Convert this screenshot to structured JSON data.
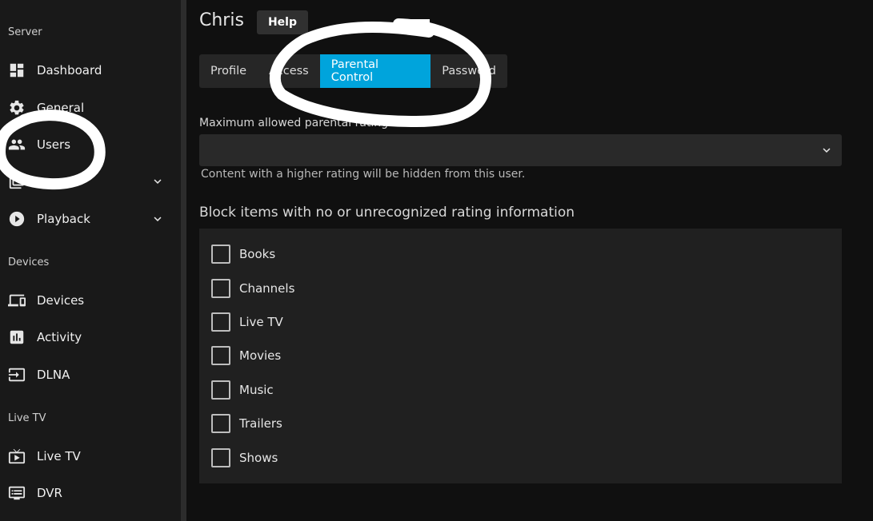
{
  "sidebar": {
    "sections": {
      "server": "Server",
      "devices": "Devices",
      "live_tv": "Live TV"
    },
    "items": [
      {
        "label": "Dashboard",
        "icon": "dashboard-icon"
      },
      {
        "label": "General",
        "icon": "gear-icon"
      },
      {
        "label": "Users",
        "icon": "users-icon"
      },
      {
        "label": "",
        "icon": "library-icon"
      },
      {
        "label": "Playback",
        "icon": "play-circle-icon"
      },
      {
        "label": "Devices",
        "icon": "devices-icon"
      },
      {
        "label": "Activity",
        "icon": "activity-icon"
      },
      {
        "label": "DLNA",
        "icon": "dlna-icon"
      },
      {
        "label": "Live TV",
        "icon": "live-tv-icon"
      },
      {
        "label": "DVR",
        "icon": "dvr-icon"
      }
    ]
  },
  "header": {
    "title": "Chris",
    "help_label": "Help"
  },
  "tabs": [
    {
      "label": "Profile",
      "active": false
    },
    {
      "label": "Access",
      "active": false
    },
    {
      "label": "Parental Control",
      "active": true
    },
    {
      "label": "Password",
      "active": false
    }
  ],
  "parental": {
    "max_rating_label": "Maximum allowed parental rating",
    "max_rating_value": "",
    "max_rating_desc": "Content with a higher rating will be hidden from this user.",
    "block_title": "Block items with no or unrecognized rating information",
    "block_items": [
      {
        "label": "Books",
        "checked": false
      },
      {
        "label": "Channels",
        "checked": false
      },
      {
        "label": "Live TV",
        "checked": false
      },
      {
        "label": "Movies",
        "checked": false
      },
      {
        "label": "Music",
        "checked": false
      },
      {
        "label": "Trailers",
        "checked": false
      },
      {
        "label": "Shows",
        "checked": false
      }
    ]
  },
  "colors": {
    "accent": "#00a4dc",
    "background": "#101010",
    "sidebar": "#191919",
    "annotation": "#ffffff"
  }
}
